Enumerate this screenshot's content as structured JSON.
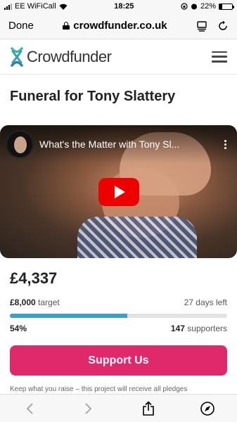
{
  "status_bar": {
    "carrier": "EE WiFiCall",
    "time": "18:25",
    "battery": "22%",
    "battery_level": 0.22
  },
  "browser": {
    "done_label": "Done",
    "url": "crowdfunder.co.uk"
  },
  "site": {
    "logo_text": "Crowdfunder",
    "brand_color": "#2a9ab3"
  },
  "project": {
    "title": "Funeral for Tony Slattery",
    "video_title": "What's the Matter with Tony Sl..."
  },
  "stats": {
    "raised": "£4,337",
    "target_amount": "£8,000",
    "target_label": "target",
    "days_left": "27 days left",
    "percent": "54%",
    "progress": 0.54,
    "supporters_count": "147",
    "supporters_label": "supporters"
  },
  "cta": {
    "support_label": "Support Us",
    "support_color": "#e0296b",
    "note": "Keep what you raise – this project will receive all pledges"
  },
  "icons": {
    "lock": "lock-icon",
    "reader": "reader-icon",
    "reload": "reload-icon",
    "menu": "menu-icon",
    "play": "play-icon",
    "back": "back-icon",
    "forward": "forward-icon",
    "share": "share-icon",
    "compass": "compass-icon"
  }
}
